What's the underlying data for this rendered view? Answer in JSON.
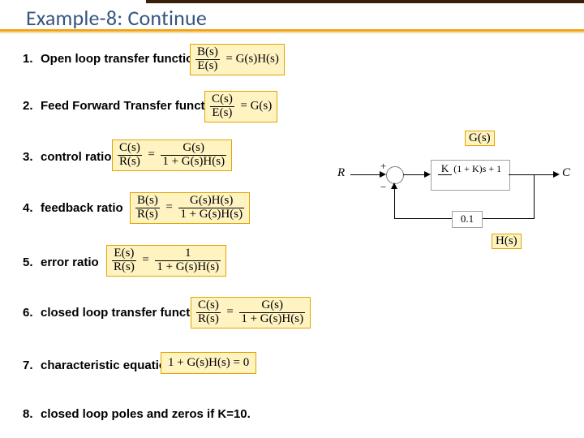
{
  "title": "Example-8: Continue",
  "items": [
    {
      "n": "1.",
      "label": "Open loop transfer function"
    },
    {
      "n": "2.",
      "label": "Feed Forward Transfer functi"
    },
    {
      "n": "3.",
      "label": "control ratio"
    },
    {
      "n": "4.",
      "label": "feedback ratio"
    },
    {
      "n": "5.",
      "label": "error ratio"
    },
    {
      "n": "6.",
      "label": "closed loop transfer function"
    },
    {
      "n": "7.",
      "label": "characteristic equatio"
    },
    {
      "n": "8.",
      "label": "closed loop poles and zeros if K=10."
    }
  ],
  "formulas": {
    "f1": {
      "lt": "B(s)",
      "lb": "E(s)",
      "rhs": "G(s)H(s)"
    },
    "f2": {
      "lt": "C(s)",
      "lb": "E(s)",
      "rhs": "G(s)"
    },
    "f3": {
      "lt": "C(s)",
      "lb": "R(s)",
      "rt": "G(s)",
      "rb": "1 + G(s)H(s)"
    },
    "f4": {
      "lt": "B(s)",
      "lb": "R(s)",
      "rt": "G(s)H(s)",
      "rb": "1 + G(s)H(s)"
    },
    "f5": {
      "lt": "E(s)",
      "lb": "R(s)",
      "rt": "1",
      "rb": "1 + G(s)H(s)"
    },
    "f6": {
      "lt": "C(s)",
      "lb": "R(s)",
      "rt": "G(s)",
      "rb": "1 + G(s)H(s)"
    },
    "f7": {
      "eq": "1 + G(s)H(s) = 0"
    }
  },
  "diagram": {
    "R": "R",
    "C": "C",
    "plus": "+",
    "minus": "−",
    "G_label": "G(s)",
    "H_label": "H(s)",
    "block_top": "K",
    "block_bot": "(1 + K)s + 1",
    "H_box": "0.1"
  }
}
